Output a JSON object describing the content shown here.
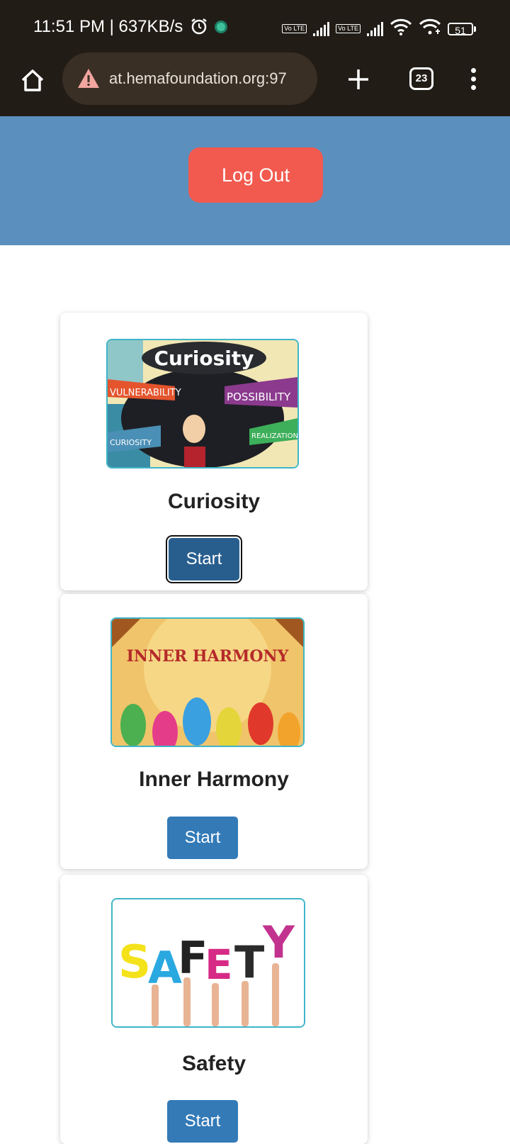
{
  "status_bar": {
    "time_speed": "11:51 PM | 637KB/s",
    "battery": "51",
    "sim1_label": "Vo LTE",
    "sim2_label": "Vo LTE"
  },
  "browser": {
    "url": "at.hemafoundation.org:97",
    "tab_count": "23"
  },
  "header": {
    "logout_label": "Log Out"
  },
  "cards": [
    {
      "title": "Curiosity",
      "image_text": "Curiosity",
      "image_words": [
        "VULNERABILITY",
        "POSSIBILITY",
        "CURIOSITY",
        "REALIZATION"
      ],
      "button": "Start"
    },
    {
      "title": "Inner Harmony",
      "image_text": "INNER HARMONY",
      "button": "Start"
    },
    {
      "title": "Safety",
      "image_letters": [
        "S",
        "A",
        "F",
        "E",
        "T",
        "Y"
      ],
      "button": "Start"
    }
  ],
  "colors": {
    "header": "#5a8fbe",
    "logout": "#f25a4f",
    "button": "#337ab7",
    "chrome": "#211c16"
  }
}
